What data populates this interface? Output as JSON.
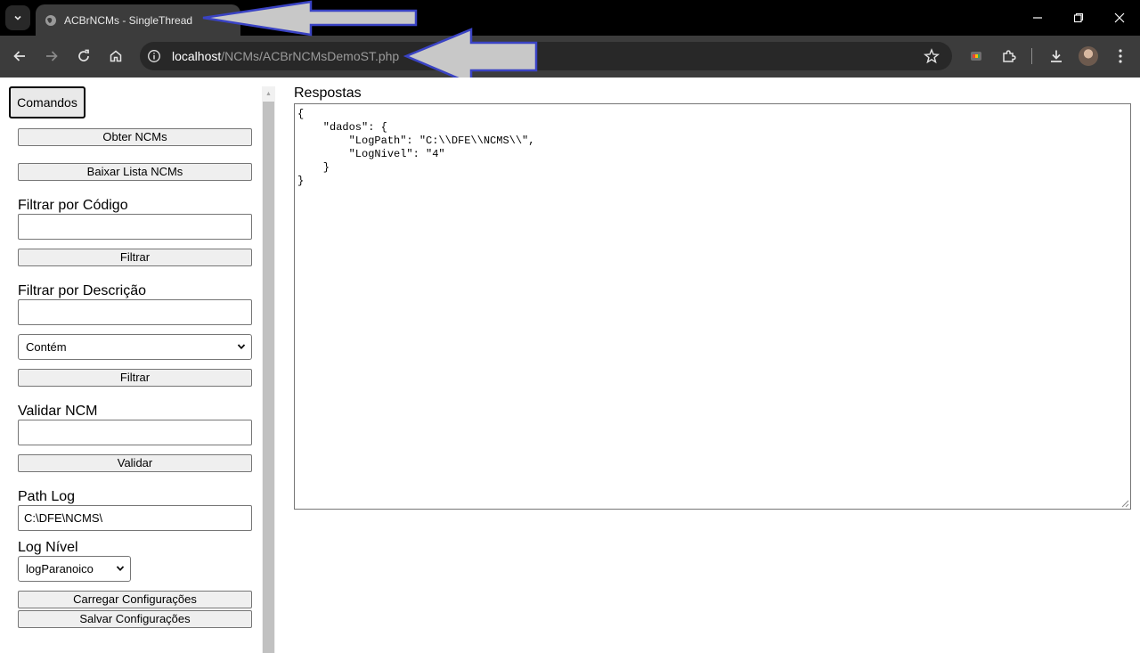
{
  "browser": {
    "tab_title": "ACBrNCMs - SingleThread",
    "tab_close": "✕",
    "new_tab": "+",
    "url_host": "localhost",
    "url_path": "/NCMs/ACBrNCMsDemoST.php"
  },
  "left_panel": {
    "tab_commands": "Comandos",
    "obter_ncms": "Obter NCMs",
    "baixar_lista": "Baixar Lista NCMs",
    "filtrar_codigo_label": "Filtrar por Código",
    "filtrar_codigo_value": "",
    "filtrar_button_1": "Filtrar",
    "filtrar_descricao_label": "Filtrar por Descrição",
    "filtrar_descricao_value": "",
    "tipo_filtro_selected": "Contém",
    "filtrar_button_2": "Filtrar",
    "validar_label": "Validar NCM",
    "validar_value": "",
    "validar_button": "Validar",
    "path_log_label": "Path Log",
    "path_log_value": "C:\\DFE\\NCMS\\",
    "log_nivel_label": "Log Nível",
    "log_nivel_selected": "logParanoico",
    "carregar_button": "Carregar Configurações",
    "salvar_button": "Salvar Configurações"
  },
  "respostas": {
    "label": "Respostas",
    "content": "{\n    \"dados\": {\n        \"LogPath\": \"C:\\\\DFE\\\\NCMS\\\\\",\n        \"LogNivel\": \"4\"\n    }\n}"
  },
  "colors": {
    "arrow_fill": "#c8c8c8",
    "arrow_stroke": "#3a43c4"
  }
}
